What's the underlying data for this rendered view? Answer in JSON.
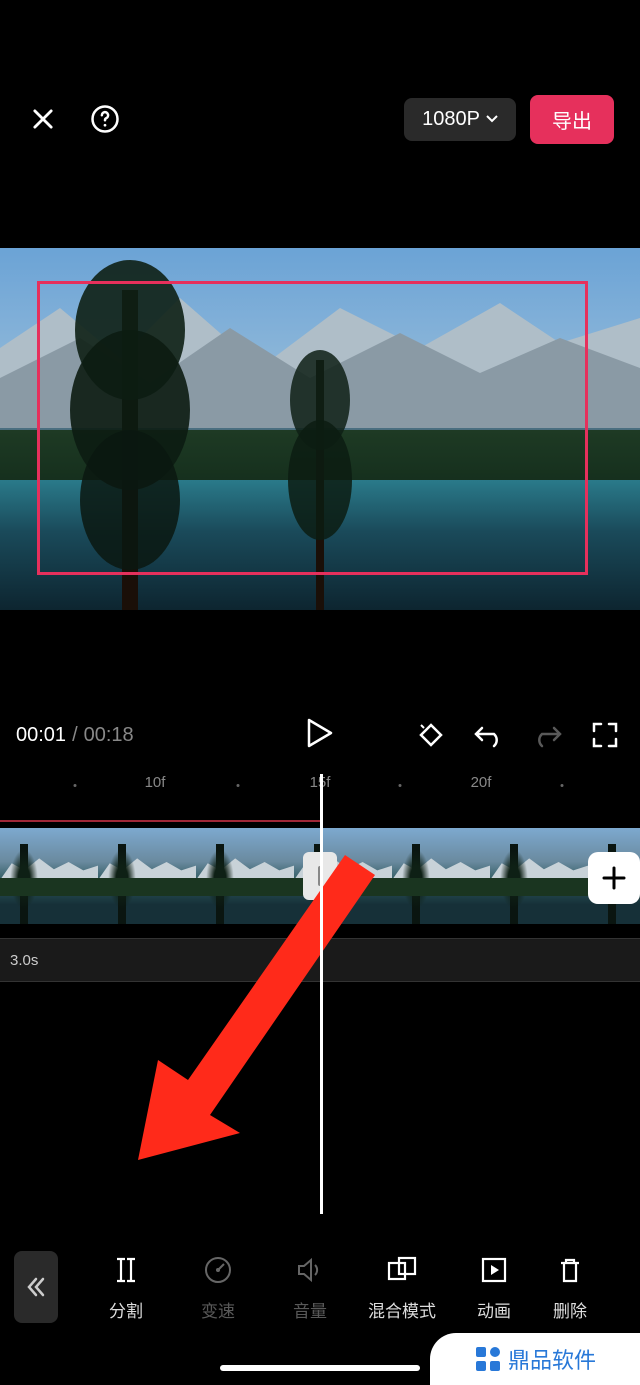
{
  "header": {
    "resolution": "1080P",
    "export_label": "导出"
  },
  "playback": {
    "current": "00:01",
    "separator": "/",
    "total": "00:18"
  },
  "ruler": {
    "marks": [
      "10f",
      "15f",
      "20f"
    ]
  },
  "track2": {
    "duration_label": "3.0s"
  },
  "toolbar": {
    "items": [
      {
        "label": "分割",
        "icon": "split-icon",
        "dim": false
      },
      {
        "label": "变速",
        "icon": "speed-icon",
        "dim": true
      },
      {
        "label": "音量",
        "icon": "volume-icon",
        "dim": true
      },
      {
        "label": "混合模式",
        "icon": "blend-icon",
        "dim": false
      },
      {
        "label": "动画",
        "icon": "animation-icon",
        "dim": false
      },
      {
        "label": "删除",
        "icon": "delete-icon",
        "dim": false
      }
    ]
  },
  "watermark": {
    "text": "鼎品软件"
  },
  "annotation": {
    "arrow_color": "#ff2a1a"
  }
}
